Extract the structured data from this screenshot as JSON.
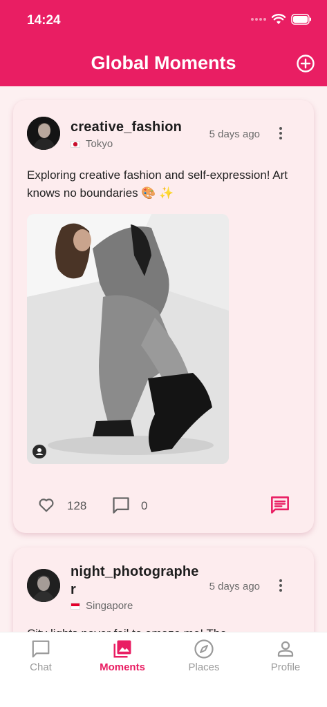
{
  "status_bar": {
    "time": "14:24"
  },
  "header": {
    "title": "Global Moments"
  },
  "posts": [
    {
      "username": "creative_fashion",
      "location": "Tokyo",
      "time_ago": "5 days ago",
      "text": "Exploring creative fashion and self-expression! Art knows no boundaries 🎨 ✨",
      "likes": "128",
      "comments": "0"
    },
    {
      "username": "night_photographer",
      "username_line1": "night_photographe",
      "username_line2": "r",
      "location": "Singapore",
      "time_ago": "5 days ago",
      "text": "City lights never fail to amaze me! The"
    }
  ],
  "nav": {
    "items": [
      {
        "label": "Chat",
        "icon": "chat-icon"
      },
      {
        "label": "Moments",
        "icon": "photo-icon",
        "active": true
      },
      {
        "label": "Places",
        "icon": "compass-icon"
      },
      {
        "label": "Profile",
        "icon": "person-icon"
      }
    ]
  },
  "colors": {
    "accent": "#e91e63",
    "background": "#fdf0f1",
    "card": "#fdecee"
  }
}
